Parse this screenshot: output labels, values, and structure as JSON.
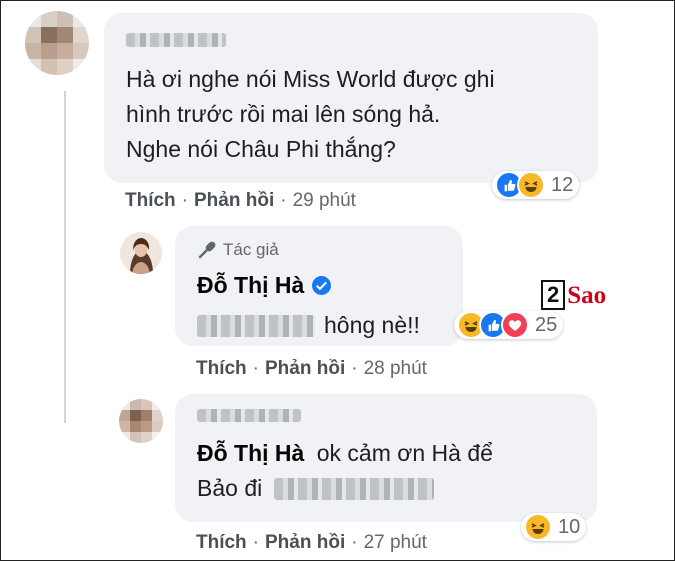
{
  "comment1": {
    "author_blurred": "",
    "text_lines": [
      "Hà ơi nghe nói Miss World được ghi",
      "hình trước rồi mai lên sóng hả.",
      "Nghe nói Châu Phi thắng?"
    ],
    "actions": {
      "like": "Thích",
      "reply": "Phản hồi",
      "time": "29 phút"
    },
    "reactions": {
      "icons": [
        "like-icon",
        "haha-icon"
      ],
      "count": "12"
    }
  },
  "reply1": {
    "badge_label": "Tác giả",
    "author": "Đỗ Thị Hà",
    "text_after_blur": "hông nè!!",
    "actions": {
      "like": "Thích",
      "reply": "Phản hồi",
      "time": "28 phút"
    },
    "reactions": {
      "icons": [
        "haha-icon",
        "like-icon",
        "love-icon"
      ],
      "count": "25"
    }
  },
  "reply2": {
    "mention": "Đỗ Thị Hà",
    "text_line1": "ok cảm ơn Hà để",
    "text_line2_prefix": "Bảo đi",
    "actions": {
      "like": "Thích",
      "reply": "Phản hồi",
      "time": "27 phút"
    },
    "reactions": {
      "icons": [
        "haha-icon"
      ],
      "count": "10"
    }
  },
  "watermark": {
    "digit": "2",
    "word": "Sao"
  },
  "colors": {
    "bubble": "#f0f2f5",
    "like": "#1877f2",
    "haha": "#f7b928",
    "love": "#f33e58",
    "verified": "#1877f2",
    "watermark": "#d0021b"
  }
}
